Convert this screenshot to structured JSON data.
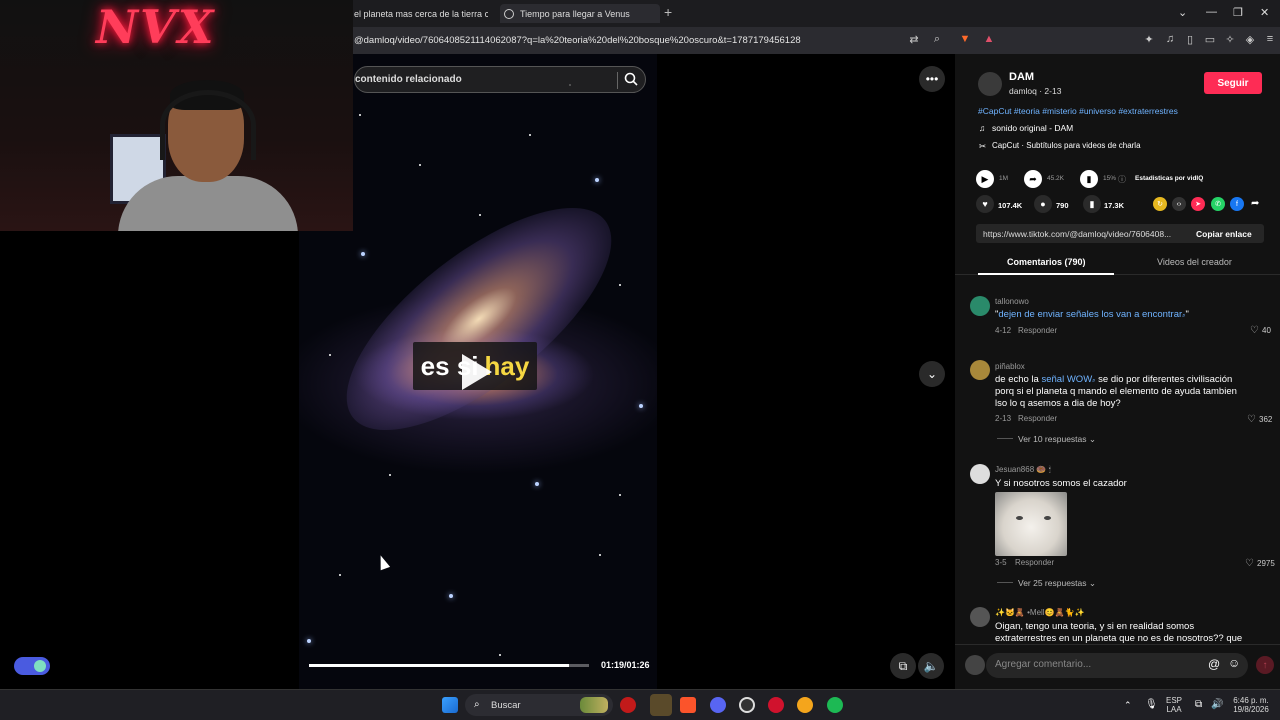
{
  "browser": {
    "tabs": [
      {
        "label": "el planeta mas cerca de la tierra cuan"
      },
      {
        "label": "Tiempo para llegar a Venus"
      }
    ],
    "new_tab_symbol": "+",
    "url": "@damloq/video/7606408521114062087?q=la%20teoria%20del%20bosque%20oscuro&t=1787179456128"
  },
  "webcam": {
    "sign_text": "NVX"
  },
  "video": {
    "search_placeholder": "contenido relacionado",
    "subtitle_word1": "es si",
    "subtitle_word2": "hay",
    "time": "01:19/01:26",
    "progress": 0.93
  },
  "author": {
    "name": "DAM",
    "handle_date": "damloq · 2-13",
    "follow_label": "Seguir",
    "hashtags": "#CapCut #teoria #misterio #universo #extraterrestres",
    "sound": "sonido original - DAM",
    "capcut": "CapCut · Subtítulos para videos de charla"
  },
  "stats": {
    "plays": "1M",
    "shares": "45.2K",
    "percent": "15%",
    "vidiq_label": "Estadisticas por vidIQ",
    "likes": "107.4K",
    "comments": "790",
    "saves": "17.3K",
    "link": "https://www.tiktok.com/@damloq/video/7606408...",
    "copy_link": "Copiar enlace"
  },
  "tabs": {
    "comments": "Comentarios (790)",
    "creator_videos": "Videos del creador"
  },
  "comments": [
    {
      "user": "tallonowo",
      "text_prefix": "\"",
      "text_link": "dejen de enviar señales los van a encontrar",
      "text_suffix": "\"",
      "date": "4-12",
      "reply": "Responder",
      "likes": "40"
    },
    {
      "user": "piñablox",
      "text_a": "de echo la ",
      "text_link": "señal WOW",
      "text_b": " se dio por diferentes civilisación",
      "line2": "porq si el planeta q mando el elemento de ayuda tambien",
      "line3": "lso lo q asemos a dia de hoy?",
      "date": "2-13",
      "reply": "Responder",
      "likes": "362",
      "view_replies": "Ver 10 respuestas"
    },
    {
      "user": "Jesuan868",
      "text": "Y si nosotros somos el cazador",
      "date": "3-5",
      "reply": "Responder",
      "likes": "2975",
      "view_replies": "Ver 25 respuestas"
    },
    {
      "user": "Mell",
      "line1": "Oigan, tengo una teoria, y si en realidad somos",
      "line2": "extraterrestres en un planeta que no es de nosotros?? que"
    }
  ],
  "comment_input": {
    "placeholder": "Agregar comentario..."
  },
  "taskbar": {
    "search_label": "Buscar",
    "lang": "ESP",
    "lang2": "LAA",
    "time": "6:46 p. m.",
    "date": "19/8/2026"
  },
  "colors": {
    "accent": "#fe2c55",
    "link": "#6fb3ff",
    "panel_bg": "#121212"
  }
}
